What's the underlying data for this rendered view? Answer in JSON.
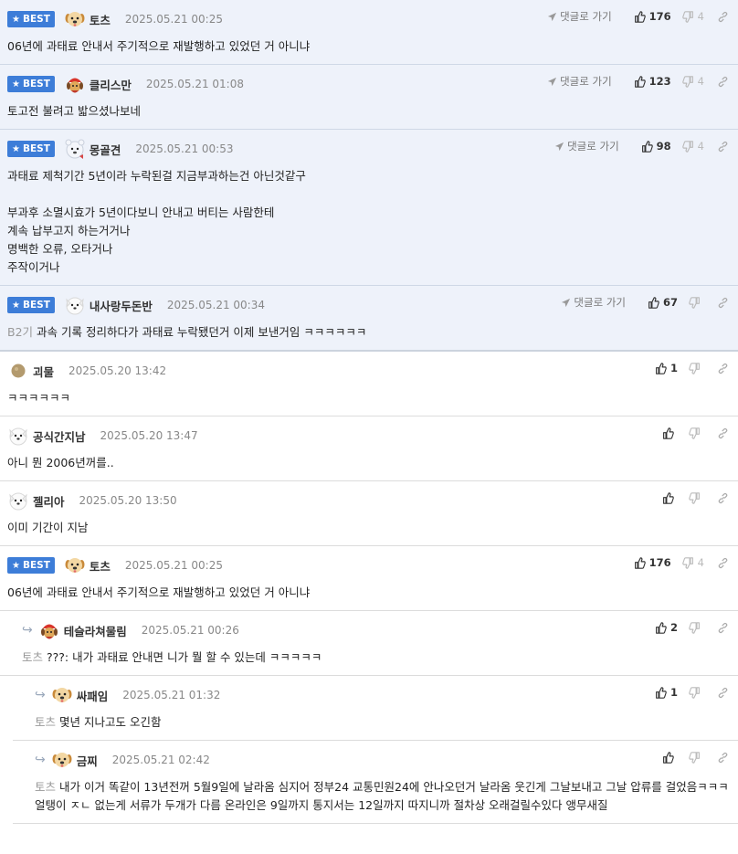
{
  "labels": {
    "best": "BEST",
    "goto": "댓글로 가기"
  },
  "colors": {
    "accent": "#3d7dd8",
    "best_bg": "#eef2fa"
  },
  "comments": [
    {
      "best": true,
      "avatar": "dog",
      "nick": "토츠",
      "date": "2025.05.21 00:25",
      "goto": true,
      "likes": "176",
      "dislikes": "4",
      "text": "06년에 과태료 안내서 주기적으로 재발행하고 있었던 거 아니냐"
    },
    {
      "best": true,
      "avatar": "santa",
      "nick": "클리스만",
      "date": "2025.05.21 01:08",
      "goto": true,
      "likes": "123",
      "dislikes": "4",
      "text": "토고전 불려고 밟으셨나보네"
    },
    {
      "best": true,
      "avatar": "bear",
      "nick": "몽골견",
      "date": "2025.05.21 00:53",
      "goto": true,
      "likes": "98",
      "dislikes": "4",
      "text": "과태료 제척기간 5년이라 누락된걸 지금부과하는건 아닌것같구\n\n부과후 소멸시효가 5년이다보니 안내고 버티는 사람한테\n계속 납부고지 하는거거나\n명백한 오류, 오타거나\n주작이거나"
    },
    {
      "best": true,
      "avatar": "puppy",
      "nick": "내사랑두돈반",
      "date": "2025.05.21 00:34",
      "goto": true,
      "likes": "67",
      "dislikes": "",
      "mention": "B2기",
      "text": "과속 기록 정리하다가 과태료 누락됐던거 이제 보낸거임 ㅋㅋㅋㅋㅋㅋ",
      "sep": true
    },
    {
      "best": false,
      "avatar": "ball",
      "nick": "괴물",
      "date": "2025.05.20 13:42",
      "goto": false,
      "likes": "1",
      "dislikes": "",
      "text": "ㅋㅋㅋㅋㅋㅋ"
    },
    {
      "best": false,
      "avatar": "puppy",
      "nick": "공식간지남",
      "date": "2025.05.20 13:47",
      "goto": false,
      "likes": "",
      "dislikes": "",
      "text": "아니 뭔 2006년꺼를.."
    },
    {
      "best": false,
      "avatar": "puppy",
      "nick": "젤리아",
      "date": "2025.05.20 13:50",
      "goto": false,
      "likes": "",
      "dislikes": "",
      "text": "이미 기간이 지남"
    },
    {
      "best": true,
      "avatar": "dog",
      "nick": "토츠",
      "date": "2025.05.21 00:25",
      "goto": false,
      "likes": "176",
      "dislikes": "4",
      "text": "06년에 과태료 안내서 주기적으로 재발행하고 있었던 거 아니냐",
      "plain": true
    },
    {
      "best": false,
      "reply": 1,
      "avatar": "santa",
      "nick": "테슬라쳐물림",
      "date": "2025.05.21 00:26",
      "goto": false,
      "likes": "2",
      "dislikes": "",
      "mention": "토츠",
      "text": "???: 내가 과태료 안내면 니가 뭘 할 수 있는데 ㅋㅋㅋㅋㅋ"
    },
    {
      "best": false,
      "reply": 2,
      "avatar": "dog",
      "nick": "싸패임",
      "date": "2025.05.21 01:32",
      "goto": false,
      "likes": "1",
      "dislikes": "",
      "mention": "토츠",
      "text": "몇년 지나고도 오긴함"
    },
    {
      "best": false,
      "reply": 2,
      "avatar": "dog",
      "nick": "금찌",
      "date": "2025.05.21 02:42",
      "goto": false,
      "likes": "",
      "dislikes": "",
      "mention": "토츠",
      "text": "내가 이거 똑같이 13년전꺼 5월9일에 날라옴 심지어 정부24 교통민원24에 안나오던거 날라옴 웃긴게 그날보내고 그날 압류를 걸었음ㅋㅋㅋ얼탱이 ㅈㄴ 없는게 서류가 두개가 다름 온라인은 9일까지 통지서는 12일까지 따지니까 절차상 오래걸릴수있다 앵무새질"
    }
  ]
}
